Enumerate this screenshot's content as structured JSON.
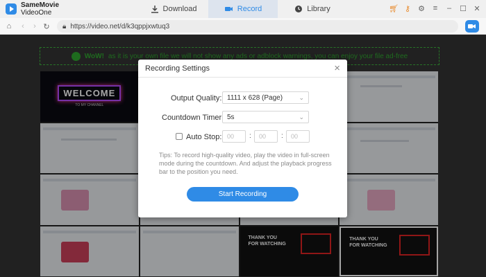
{
  "app": {
    "name_line1": "SameMovie",
    "name_line2": "VideoOne"
  },
  "tabs": [
    {
      "label": "Download"
    },
    {
      "label": "Record"
    },
    {
      "label": "Library"
    }
  ],
  "window_controls": [
    "cart-icon",
    "key-icon",
    "settings-icon",
    "menu-icon",
    "minimize-icon",
    "maximize-icon",
    "close-icon"
  ],
  "address_bar": {
    "url": "https://video.net/d/k3qppjxwtuq3"
  },
  "banner": {
    "text": "as it is your own file we will not show any ads or adblock warnings, you can enjoy your file ad-free",
    "emphasis": "WoW!"
  },
  "thumbnails": {
    "welcome_title": "WELCOME",
    "welcome_sub": "TO MY CHANNEL",
    "thanks_line1": "THANK YOU",
    "thanks_line2": "FOR WATCHING"
  },
  "dialog": {
    "title": "Recording Settings",
    "output_quality_label": "Output Quality:",
    "output_quality_value": "1111 x 628 (Page)",
    "countdown_label": "Countdown Timer:",
    "countdown_value": "5s",
    "auto_stop_label": "Auto Stop:",
    "auto_stop_h": "00",
    "auto_stop_m": "00",
    "auto_stop_s": "00",
    "tips": "Tips: To record high-quality video, play the video in full-screen mode during the countdown. And adjust the playback progress bar to the position you need.",
    "start_button": "Start Recording"
  },
  "colors": {
    "accent": "#2f8be6",
    "banner": "#2fa52f"
  }
}
